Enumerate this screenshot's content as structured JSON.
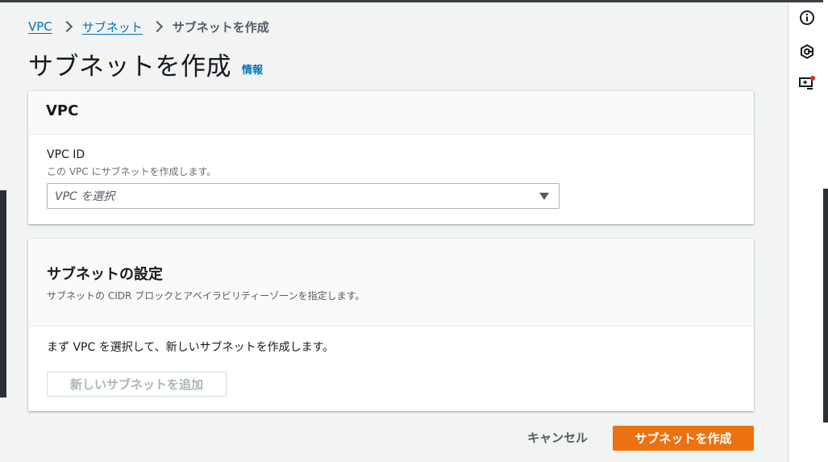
{
  "breadcrumb": {
    "items": [
      "VPC",
      "サブネット"
    ],
    "current": "サブネットを作成"
  },
  "page": {
    "title": "サブネットを作成",
    "info_link": "情報"
  },
  "vpc_panel": {
    "heading": "VPC",
    "field_label": "VPC ID",
    "field_description": "この VPC にサブネットを作成します。",
    "select_placeholder": "VPC を選択"
  },
  "subnet_panel": {
    "heading": "サブネットの設定",
    "description": "サブネットの CIDR ブロックとアベイラビリティーゾーンを指定します。",
    "body_text": "まず VPC を選択して、新しいサブネットを作成します。",
    "add_button": "新しいサブネットを追加"
  },
  "actions": {
    "cancel": "キャンセル",
    "create": "サブネットを作成"
  },
  "rail": {
    "icons": [
      "info-icon",
      "hexagon-settings-icon",
      "feedback-icon"
    ],
    "notification_color": "#d13212"
  },
  "colors": {
    "link": "#0073bb",
    "primary_button": "#ec7211"
  }
}
